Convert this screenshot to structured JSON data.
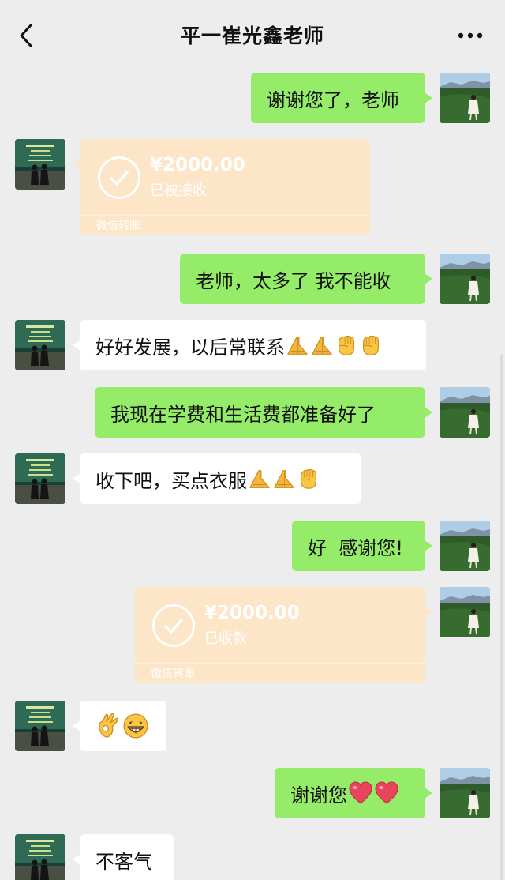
{
  "header": {
    "title": "平一崔光鑫老师",
    "back_icon": "chevron-left-icon",
    "more_icon": "more-dots-icon"
  },
  "messages": [
    {
      "direction": "out",
      "type": "text",
      "text": "谢谢您了，老师"
    },
    {
      "direction": "in",
      "type": "transfer",
      "amount": "¥2000.00",
      "status": "已被接收",
      "label": "微信转账"
    },
    {
      "direction": "out",
      "type": "text",
      "text": "老师，太多了 我不能收"
    },
    {
      "direction": "in",
      "type": "text",
      "text": "好好发展，以后常联系",
      "emojis": [
        "pray",
        "pray",
        "fist",
        "fist"
      ]
    },
    {
      "direction": "out",
      "type": "text",
      "text": "我现在学费和生活费都准备好了"
    },
    {
      "direction": "in",
      "type": "text",
      "text": "收下吧，买点衣服",
      "emojis": [
        "pray",
        "pray",
        "fist"
      ]
    },
    {
      "direction": "out",
      "type": "text",
      "text": "好  感谢您!"
    },
    {
      "direction": "out",
      "type": "transfer",
      "amount": "¥2000.00",
      "status": "已收款",
      "label": "微信转账"
    },
    {
      "direction": "in",
      "type": "emoji",
      "emojis": [
        "ok-hand",
        "grin"
      ]
    },
    {
      "direction": "out",
      "type": "text",
      "text": "谢谢您",
      "emojis": [
        "heart",
        "heart"
      ]
    },
    {
      "direction": "in",
      "type": "text",
      "text": "不客气"
    }
  ],
  "colors": {
    "background": "#ededed",
    "outgoing_bubble": "#95ec69",
    "incoming_bubble": "#ffffff",
    "transfer_card": "#fde5c8"
  }
}
